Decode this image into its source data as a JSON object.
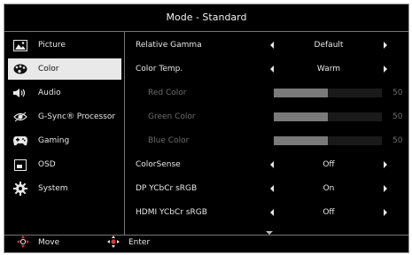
{
  "title": "Mode - Standard",
  "sidebar": {
    "items": [
      {
        "label": "Picture",
        "icon": "picture-icon",
        "active": false
      },
      {
        "label": "Color",
        "icon": "color-palette-icon",
        "active": true
      },
      {
        "label": "Audio",
        "icon": "speaker-icon",
        "active": false
      },
      {
        "label": "G-Sync® Processor",
        "icon": "eye-icon",
        "active": false
      },
      {
        "label": "Gaming",
        "icon": "gamepad-icon",
        "active": false
      },
      {
        "label": "OSD",
        "icon": "osd-window-icon",
        "active": false
      },
      {
        "label": "System",
        "icon": "gear-icon",
        "active": false
      }
    ]
  },
  "settings": [
    {
      "label": "Relative Gamma",
      "value": "Default",
      "type": "select"
    },
    {
      "label": "Color Temp.",
      "value": "Warm",
      "type": "select"
    },
    {
      "label": "Red Color",
      "value": "50",
      "level": 0.5,
      "type": "slider"
    },
    {
      "label": "Green Color",
      "value": "50",
      "level": 0.5,
      "type": "slider"
    },
    {
      "label": "Blue Color",
      "value": "50",
      "level": 0.5,
      "type": "slider"
    },
    {
      "label": "ColorSense",
      "value": "Off",
      "type": "select"
    },
    {
      "label": "DP YCbCr sRGB",
      "value": "On",
      "type": "select"
    },
    {
      "label": "HDMI YCbCr sRGB",
      "value": "Off",
      "type": "select"
    }
  ],
  "footer": {
    "move_label": "Move",
    "enter_label": "Enter"
  },
  "colors": {
    "background": "#000000",
    "active_item": "#e9e9e9",
    "accent_red": "#d63a3a"
  }
}
